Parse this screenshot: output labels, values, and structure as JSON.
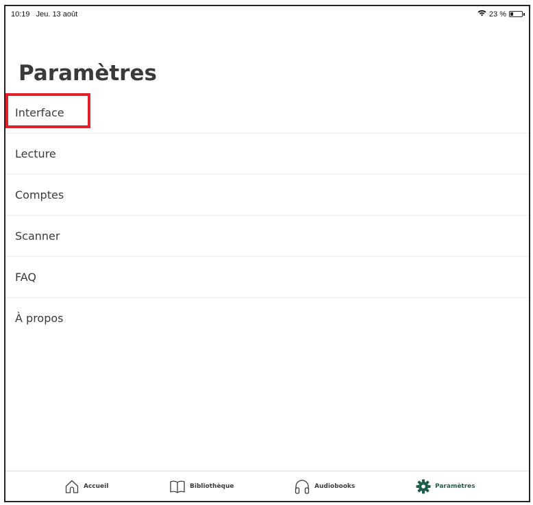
{
  "status_bar": {
    "time": "10:19",
    "date": "Jeu. 13 août",
    "battery_text": "23 %",
    "battery_level": 0.23,
    "wifi_icon": "wifi-icon"
  },
  "page": {
    "title": "Paramètres"
  },
  "settings_items": [
    {
      "label": "Interface"
    },
    {
      "label": "Lecture"
    },
    {
      "label": "Comptes",
      "highlighted": true
    },
    {
      "label": "Scanner"
    },
    {
      "label": "FAQ"
    },
    {
      "label": "À propos"
    }
  ],
  "tab_bar": {
    "tabs": [
      {
        "label": "Accueil",
        "icon": "home-icon"
      },
      {
        "label": "Bibliothèque",
        "icon": "book-icon"
      },
      {
        "label": "Audiobooks",
        "icon": "headphones-icon"
      },
      {
        "label": "Paramètres",
        "icon": "gear-icon",
        "active": true
      }
    ]
  },
  "colors": {
    "accent": "#1f5e4d",
    "highlight": "#e0202a",
    "text": "#3a3a3a"
  }
}
